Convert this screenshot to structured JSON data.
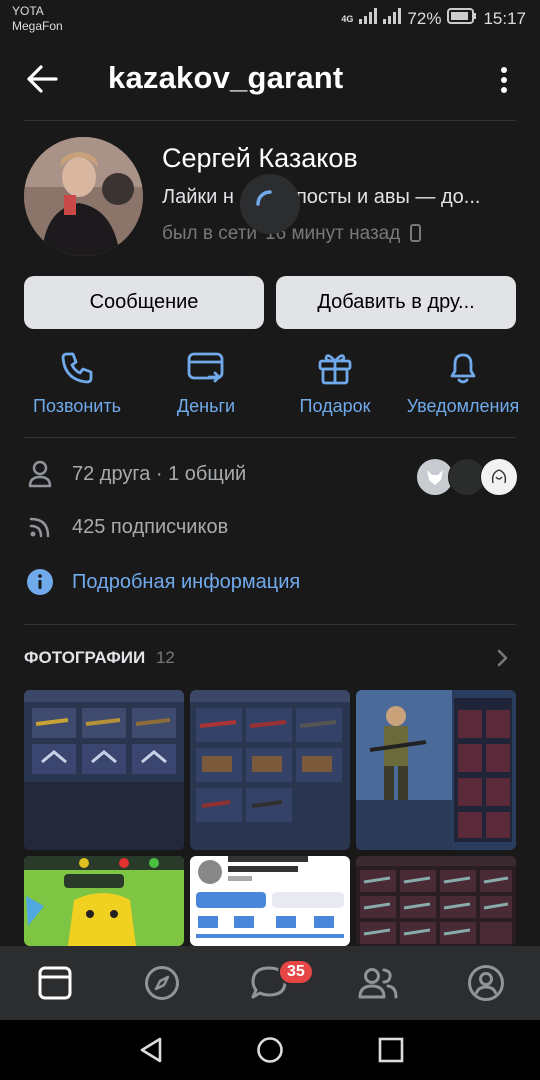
{
  "status_bar": {
    "carrier1": "YOTA",
    "carrier2": "MegaFon",
    "network": "4G",
    "battery": "72%",
    "time": "15:17"
  },
  "header": {
    "title": "kazakov_garant"
  },
  "profile": {
    "name": "Сергей Казаков",
    "status_left": "Лайки н",
    "status_right": "посты и авы — до...",
    "last_seen_left": "был в сети",
    "last_seen_right": "16 минут назад"
  },
  "buttons": {
    "message": "Сообщение",
    "add_friend": "Добавить в дру..."
  },
  "actions": [
    {
      "label": "Позвонить",
      "icon": "phone-icon"
    },
    {
      "label": "Деньги",
      "icon": "money-icon"
    },
    {
      "label": "Подарок",
      "icon": "gift-icon"
    },
    {
      "label": "Уведомления",
      "icon": "bell-icon"
    }
  ],
  "info": {
    "friends": "72 друга · 1 общий",
    "followers": "425 подписчиков",
    "details": "Подробная информация"
  },
  "photos": {
    "title": "ФОТОГРАФИИ",
    "count": "12"
  },
  "bottom_nav": {
    "messages_badge": "35"
  },
  "colors": {
    "accent": "#71aaeb",
    "background": "#19191a",
    "badge": "#e64646"
  }
}
